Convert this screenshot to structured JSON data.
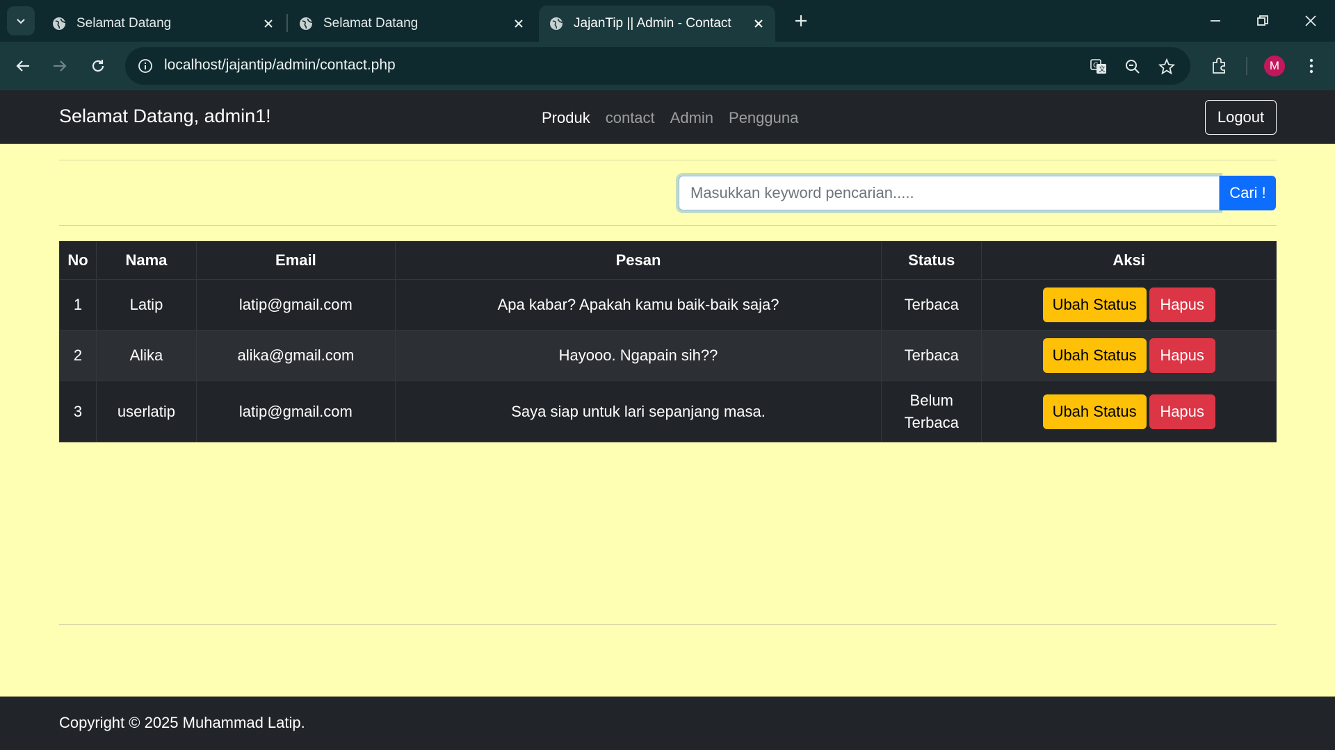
{
  "browser": {
    "tabs": [
      {
        "title": "Selamat Datang",
        "active": false
      },
      {
        "title": "Selamat Datang",
        "active": false
      },
      {
        "title": "JajanTip || Admin - Contact",
        "active": true
      }
    ],
    "url": "localhost/jajantip/admin/contact.php",
    "profile_initial": "M"
  },
  "navbar": {
    "brand": "Selamat Datang, admin1!",
    "links": [
      {
        "label": "Produk",
        "active": true
      },
      {
        "label": "contact",
        "active": false
      },
      {
        "label": "Admin",
        "active": false
      },
      {
        "label": "Pengguna",
        "active": false
      }
    ],
    "logout_label": "Logout"
  },
  "search": {
    "placeholder": "Masukkan keyword pencarian.....",
    "button_label": "Cari !"
  },
  "table": {
    "headers": [
      "No",
      "Nama",
      "Email",
      "Pesan",
      "Status",
      "Aksi"
    ],
    "rows": [
      {
        "no": "1",
        "nama": "Latip",
        "email": "latip@gmail.com",
        "pesan": "Apa kabar? Apakah kamu baik-baik saja?",
        "status": "Terbaca"
      },
      {
        "no": "2",
        "nama": "Alika",
        "email": "alika@gmail.com",
        "pesan": "Hayooo. Ngapain sih??",
        "status": "Terbaca"
      },
      {
        "no": "3",
        "nama": "userlatip",
        "email": "latip@gmail.com",
        "pesan": "Saya siap untuk lari sepanjang masa.",
        "status": "Belum Terbaca"
      }
    ],
    "action_labels": {
      "change_status": "Ubah Status",
      "delete": "Hapus"
    }
  },
  "footer": {
    "text": "Copyright © 2025 Muhammad Latip."
  },
  "colors": {
    "page_bg": "#ffffb3",
    "navbar_bg": "#212529",
    "primary": "#0d6efd",
    "warning": "#ffc107",
    "danger": "#dc3545"
  }
}
